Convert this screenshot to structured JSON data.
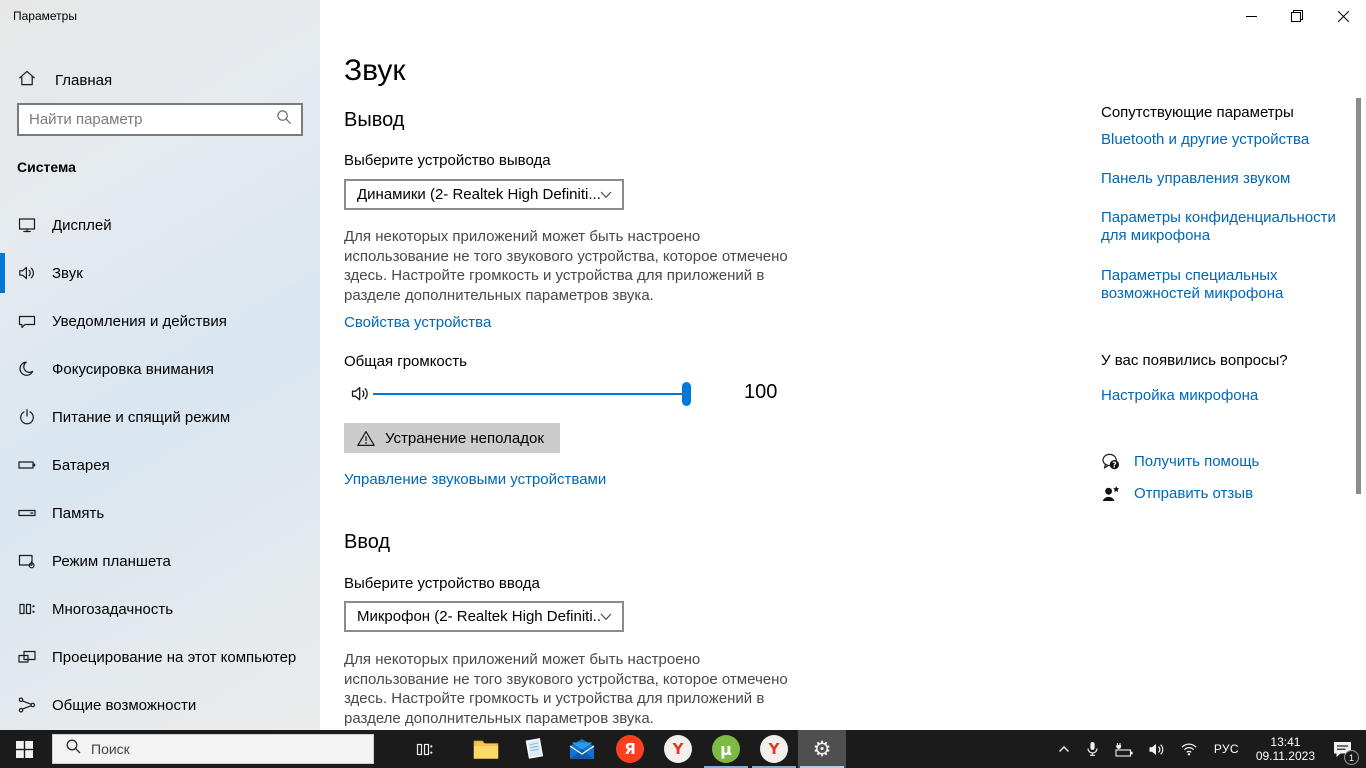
{
  "titlebar": {
    "title": "Параметры"
  },
  "sidebar": {
    "home_label": "Главная",
    "search_placeholder": "Найти параметр",
    "section_label": "Система",
    "items": [
      {
        "label": "Дисплей",
        "selected": false
      },
      {
        "label": "Звук",
        "selected": true
      },
      {
        "label": "Уведомления и действия",
        "selected": false
      },
      {
        "label": "Фокусировка внимания",
        "selected": false
      },
      {
        "label": "Питание и спящий режим",
        "selected": false
      },
      {
        "label": "Батарея",
        "selected": false
      },
      {
        "label": "Память",
        "selected": false
      },
      {
        "label": "Режим планшета",
        "selected": false
      },
      {
        "label": "Многозадачность",
        "selected": false
      },
      {
        "label": "Проецирование на этот компьютер",
        "selected": false
      },
      {
        "label": "Общие возможности",
        "selected": false
      }
    ]
  },
  "page": {
    "title": "Звук",
    "output": {
      "heading": "Вывод",
      "device_label": "Выберите устройство вывода",
      "device_value": "Динамики (2- Realtek High Definiti...",
      "description": "Для некоторых приложений может быть настроено использование не того звукового устройства, которое отмечено здесь. Настройте громкость и устройства для приложений в разделе дополнительных параметров звука.",
      "device_properties_link": "Свойства устройства",
      "volume_label": "Общая громкость",
      "volume_value": "100",
      "troubleshoot_button": "Устранение неполадок",
      "manage_devices_link": "Управление звуковыми устройствами"
    },
    "input": {
      "heading": "Ввод",
      "device_label": "Выберите устройство ввода",
      "device_value": "Микрофон (2- Realtek High Definiti...",
      "description": "Для некоторых приложений может быть настроено использование не того звукового устройства, которое отмечено здесь. Настройте громкость и устройства для приложений в разделе дополнительных параметров звука."
    }
  },
  "related": {
    "heading": "Сопутствующие параметры",
    "links": [
      "Bluetooth и другие устройства",
      "Панель управления звуком",
      "Параметры конфиденциальности для микрофона",
      "Параметры специальных возможностей микрофона"
    ]
  },
  "questions": {
    "heading": "У вас появились вопросы?",
    "link": "Настройка микрофона"
  },
  "support": {
    "get_help": "Получить помощь",
    "send_feedback": "Отправить отзыв"
  },
  "taskbar": {
    "search_placeholder": "Поиск",
    "apps": [
      "file-explorer",
      "notepad",
      "mail",
      "yandex",
      "yandex-browser",
      "utorrent",
      "yandex-browser-2",
      "settings"
    ],
    "yandex_letter": "Я",
    "ybrowser_letter": "Y",
    "utorrent_letter": "µ",
    "gear_glyph": "⚙",
    "tray": {
      "language": "РУС",
      "time": "13:41",
      "date": "09.11.2023",
      "notification_count": "1"
    }
  },
  "colors": {
    "accent": "#0078d7",
    "link": "#0067b8",
    "taskbar": "#1b1b1c"
  }
}
